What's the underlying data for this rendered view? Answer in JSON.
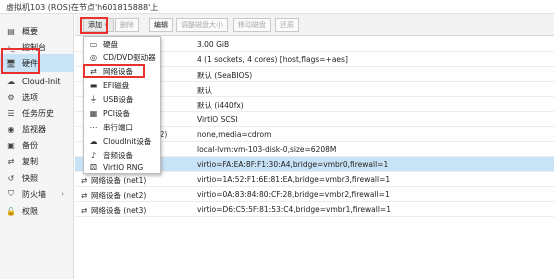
{
  "window_title": "虚拟机103 (ROS)在节点'h601815888'上",
  "sidebar": {
    "items": [
      {
        "label": "概要",
        "icon": "document-icon"
      },
      {
        "label": "控制台",
        "icon": "terminal-icon"
      },
      {
        "label": "硬件",
        "icon": "monitor-icon",
        "active": true
      },
      {
        "label": "Cloud-Init",
        "icon": "cloud-icon"
      },
      {
        "label": "选项",
        "icon": "gear-icon"
      },
      {
        "label": "任务历史",
        "icon": "list-icon"
      },
      {
        "label": "监视器",
        "icon": "eye-icon"
      },
      {
        "label": "备份",
        "icon": "save-icon"
      },
      {
        "label": "复制",
        "icon": "retweet-icon"
      },
      {
        "label": "快照",
        "icon": "history-icon"
      },
      {
        "label": "防火墙",
        "icon": "shield-icon",
        "has_submenu": true
      },
      {
        "label": "权限",
        "icon": "unlock-icon"
      }
    ]
  },
  "toolbar": {
    "add_label": "添加",
    "add_caret": "∨",
    "remove_label": "删除",
    "edit_label": "编辑",
    "resize_label": "调整磁盘大小",
    "move_label": "移动磁盘",
    "revert_label": "还原"
  },
  "hardware_rows": [
    {
      "name": "",
      "value": "3.00 GiB"
    },
    {
      "name": "",
      "value": "4 (1 sockets, 4 cores) [host,flags=+aes]"
    },
    {
      "name": "",
      "value": "默认 (SeaBIOS)"
    },
    {
      "name": "",
      "value": "默认"
    },
    {
      "name": "",
      "value": "默认 (i440fx)"
    },
    {
      "name": "",
      "value": "VirtIO SCSI"
    },
    {
      "name": "e2)",
      "value": "none,media=cdrom"
    },
    {
      "name": "",
      "value": "local-lvm:vm-103-disk-0,size=6208M"
    },
    {
      "name": "",
      "value": "virtio=FA:EA:8F:F1:30:A4,bridge=vmbr0,firewall=1",
      "selected": true
    },
    {
      "name": "网络设备 (net1)",
      "value": "virtio=1A:52:F1:6E:81:EA,bridge=vmbr3,firewall=1"
    },
    {
      "name": "网络设备 (net2)",
      "value": "virtio=0A:83:84:80:CF:28,bridge=vmbr2,firewall=1"
    },
    {
      "name": "网络设备 (net3)",
      "value": "virtio=D6:C5:5F:81:53:C4,bridge=vmbr1,firewall=1"
    }
  ],
  "add_menu": {
    "items": [
      {
        "label": "硬盘",
        "icon": "hdd-icon"
      },
      {
        "label": "CD/DVD驱动器",
        "icon": "cd-icon"
      },
      {
        "label": "网络设备",
        "icon": "network-icon"
      },
      {
        "label": "EFI磁盘",
        "icon": "efi-disk-icon"
      },
      {
        "label": "USB设备",
        "icon": "usb-icon"
      },
      {
        "label": "PCI设备",
        "icon": "pci-icon"
      },
      {
        "label": "串行端口",
        "icon": "serial-icon"
      },
      {
        "label": "CloudInit设备",
        "icon": "cloud-icon"
      },
      {
        "label": "音频设备",
        "icon": "volume-icon"
      },
      {
        "label": "VirtIO RNG",
        "icon": "rng-icon"
      }
    ]
  },
  "colors": {
    "highlight": "#e8322e",
    "selection": "#c9e3f6"
  }
}
